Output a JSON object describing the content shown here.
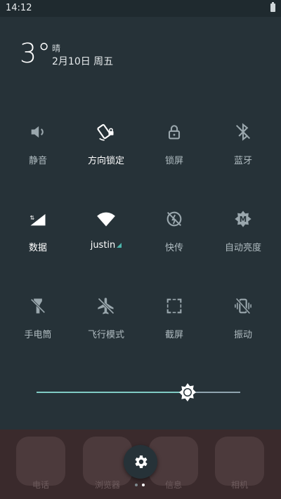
{
  "status": {
    "time": "14:12"
  },
  "header": {
    "temperature": "3°",
    "condition": "晴",
    "date": "2月10日 周五"
  },
  "tiles": [
    {
      "label": "静音",
      "icon": "volume-icon",
      "active": false
    },
    {
      "label": "方向锁定",
      "icon": "rotation-lock-icon",
      "active": true
    },
    {
      "label": "锁屏",
      "icon": "lock-icon",
      "active": false
    },
    {
      "label": "蓝牙",
      "icon": "bluetooth-off-icon",
      "active": false
    },
    {
      "label": "数据",
      "icon": "cellular-data-icon",
      "active": true
    },
    {
      "label": "justin",
      "icon": "wifi-icon",
      "active": true
    },
    {
      "label": "快传",
      "icon": "quick-transfer-off-icon",
      "active": false
    },
    {
      "label": "自动亮度",
      "icon": "auto-brightness-icon",
      "active": false
    },
    {
      "label": "手电筒",
      "icon": "flashlight-off-icon",
      "active": false
    },
    {
      "label": "飞行模式",
      "icon": "airplane-off-icon",
      "active": false
    },
    {
      "label": "截屏",
      "icon": "screenshot-icon",
      "active": false
    },
    {
      "label": "振动",
      "icon": "vibrate-off-icon",
      "active": false
    }
  ],
  "brightness": {
    "level": 0.74
  },
  "dock": {
    "labels": [
      "电话",
      "浏览器",
      "信息",
      "相机"
    ]
  },
  "pager": {
    "count": 2,
    "current": 1
  },
  "colors": {
    "accent": "#80cbc4",
    "panel": "#263238",
    "wifi_indicator": "#4db6ac"
  }
}
